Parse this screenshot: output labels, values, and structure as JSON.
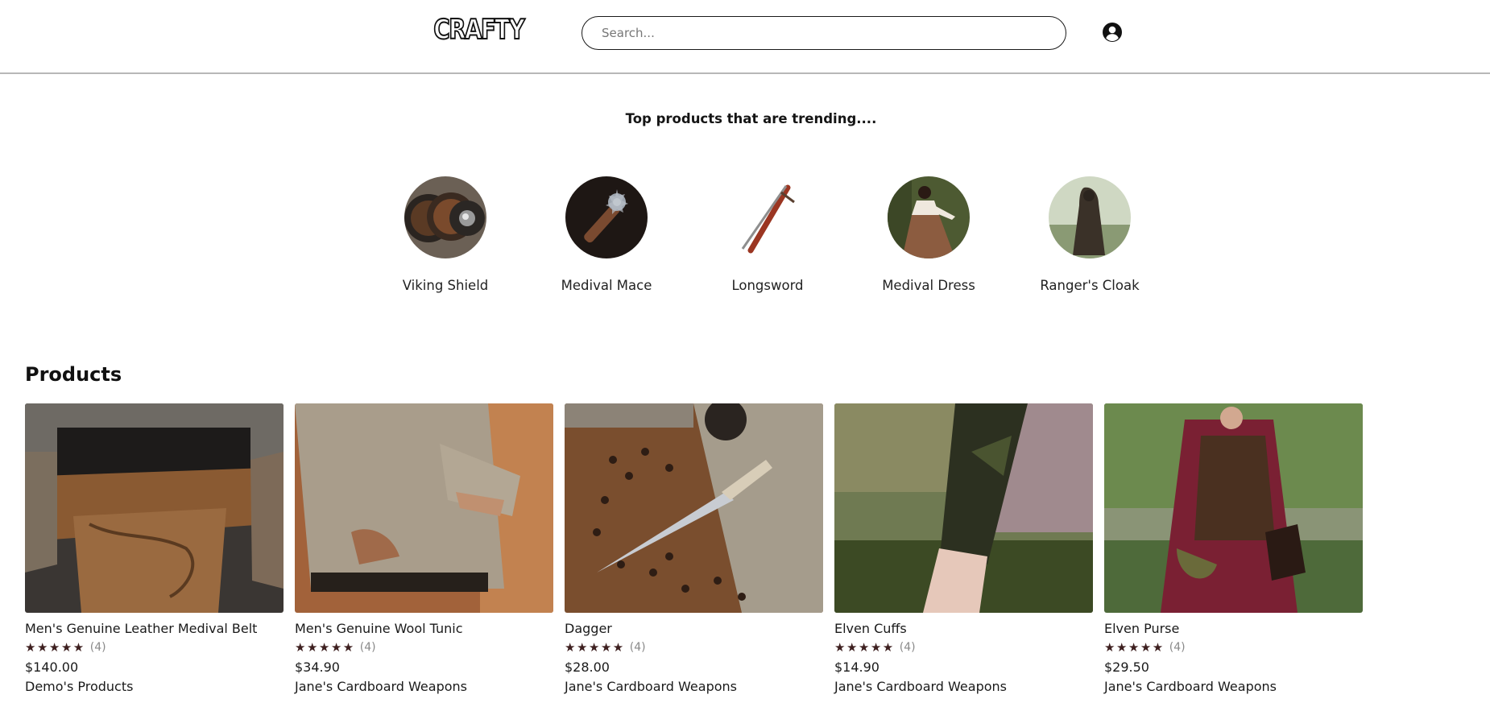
{
  "header": {
    "logo_text": "CRAFTY",
    "search_placeholder": "Search...",
    "account_icon": "user-circle-icon"
  },
  "trending": {
    "title": "Top products that are trending....",
    "items": [
      {
        "label": "Viking Shield"
      },
      {
        "label": "Medival Mace"
      },
      {
        "label": "Longsword"
      },
      {
        "label": "Medival Dress"
      },
      {
        "label": "Ranger's Cloak"
      }
    ]
  },
  "products": {
    "title": "Products",
    "items": [
      {
        "name": "Men's Genuine Leather Medival Belt",
        "stars": "★★★★★",
        "review_count": "(4)",
        "price": "$140.00",
        "seller": "Demo's Products"
      },
      {
        "name": "Men's Genuine Wool Tunic",
        "stars": "★★★★★",
        "review_count": "(4)",
        "price": "$34.90",
        "seller": "Jane's Cardboard Weapons"
      },
      {
        "name": "Dagger",
        "stars": "★★★★★",
        "review_count": "(4)",
        "price": "$28.00",
        "seller": "Jane's Cardboard Weapons"
      },
      {
        "name": "Elven Cuffs",
        "stars": "★★★★★",
        "review_count": "(4)",
        "price": "$14.90",
        "seller": "Jane's Cardboard Weapons"
      },
      {
        "name": "Elven Purse",
        "stars": "★★★★★",
        "review_count": "(4)",
        "price": "$29.50",
        "seller": "Jane's Cardboard Weapons"
      }
    ]
  },
  "colors": {
    "star": "#3d1f1f",
    "border": "#b8b8b8",
    "text": "#1c1c1c"
  }
}
